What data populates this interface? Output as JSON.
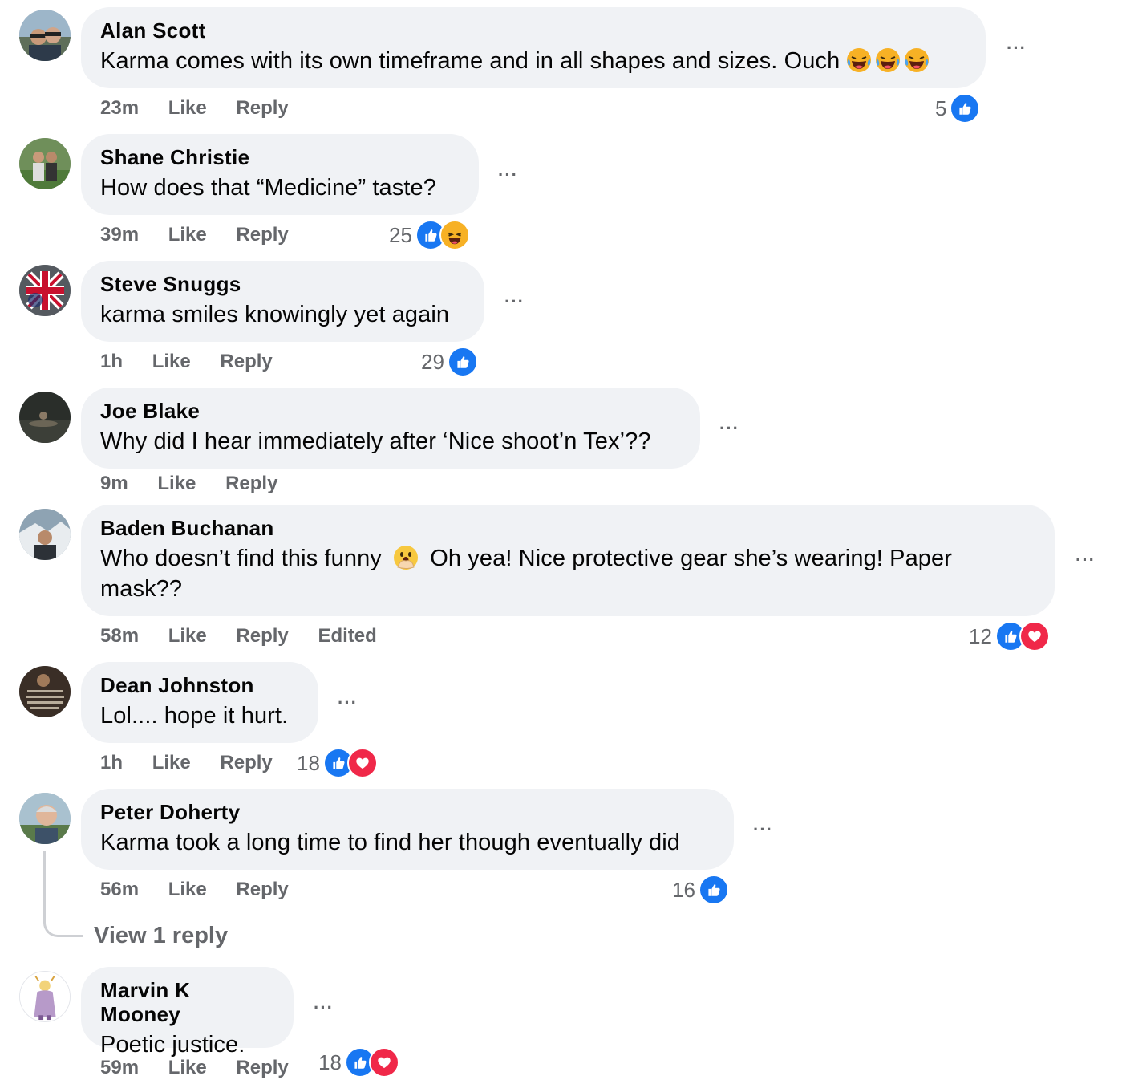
{
  "comments": [
    {
      "author": "Alan Scott",
      "text": "Karma comes with its own timeframe and in all shapes and sizes. Ouch",
      "time": "23m",
      "like": "Like",
      "reply": "Reply",
      "reaction_count": "5",
      "reactions": [
        "like-icon"
      ],
      "emojis": [
        "rolling-laughing-icon",
        "rolling-laughing-icon",
        "rolling-laughing-icon"
      ]
    },
    {
      "author": "Shane Christie",
      "text": "How does that “Medicine” taste?",
      "time": "39m",
      "like": "Like",
      "reply": "Reply",
      "reaction_count": "25",
      "reactions": [
        "like-icon",
        "haha-icon"
      ]
    },
    {
      "author": "Steve Snuggs",
      "text": "karma smiles knowingly yet again",
      "time": "1h",
      "like": "Like",
      "reply": "Reply",
      "reaction_count": "29",
      "reactions": [
        "like-icon"
      ]
    },
    {
      "author": "Joe Blake",
      "text": "Why did I hear immediately after ‘Nice shoot’n Tex’??",
      "time": "9m",
      "like": "Like",
      "reply": "Reply"
    },
    {
      "author": "Baden Buchanan",
      "text_part1": "Who doesn’t find this funny",
      "text_part2": "Oh yea! Nice protective gear she’s wearing! Paper mask??",
      "time": "58m",
      "like": "Like",
      "reply": "Reply",
      "edited": "Edited",
      "reaction_count": "12",
      "reactions": [
        "like-icon",
        "love-icon"
      ],
      "emojis": [
        "hand-over-mouth-icon"
      ]
    },
    {
      "author": "Dean Johnston",
      "text": "Lol.... hope it hurt.",
      "time": "1h",
      "like": "Like",
      "reply": "Reply",
      "reaction_count": "18",
      "reactions": [
        "like-icon",
        "love-icon"
      ]
    },
    {
      "author": "Peter Doherty",
      "text": "Karma took a long time to find her though eventually did",
      "time": "56m",
      "like": "Like",
      "reply": "Reply",
      "reaction_count": "16",
      "reactions": [
        "like-icon"
      ]
    },
    {
      "author": "Marvin K Mooney",
      "text": "Poetic justice.",
      "time": "59m",
      "like": "Like",
      "reply": "Reply",
      "reaction_count": "18",
      "reactions": [
        "like-icon",
        "love-icon"
      ]
    }
  ],
  "view_replies": "View 1 reply",
  "more_label": "···",
  "colors": {
    "like": "#1877f2",
    "love": "#f02849",
    "haha": "#f7b125",
    "bubble": "#f0f2f5",
    "meta": "#65676b"
  }
}
